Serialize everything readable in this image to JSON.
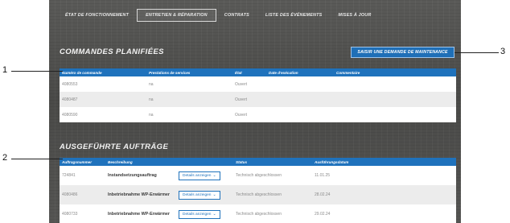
{
  "nav": {
    "tabs": [
      {
        "label": "ÉTAT DE FONCTIONNEMENT"
      },
      {
        "label": "ENTRETIEN & RÉPARATION"
      },
      {
        "label": "CONTRATS"
      },
      {
        "label": "LISTE DES ÉVÉNEMENTS"
      },
      {
        "label": "MISES À JOUR"
      }
    ],
    "active_tab": "ENTRETIEN & RÉPARATION"
  },
  "planned": {
    "title": "COMMANDES PLANIFIÉES",
    "request_button": "SAISIR UNE DEMANDE DE MAINTENANCE",
    "columns": [
      "Numéro de commande",
      "Prestations de services",
      "État",
      "Date d'exécution",
      "Commentaire"
    ],
    "rows": [
      [
        "4080553",
        "na",
        "Ouvert",
        "",
        ""
      ],
      [
        "4080487",
        "na",
        "Ouvert",
        "",
        ""
      ],
      [
        "4080590",
        "na",
        "Ouvert",
        "",
        ""
      ]
    ]
  },
  "executed": {
    "title": "AUSGEFÜHRTE AUFTRÄGE",
    "columns": [
      "Auftragsnummer",
      "Beschreibung",
      "",
      "Status",
      "Ausführungsdatum"
    ],
    "details_label": "Details anzeigen",
    "rows": [
      [
        "724841",
        "Instandsetzungsauftrag",
        "Technisch abgeschlossen",
        "11.01.25"
      ],
      [
        "4080486",
        "Inbetriebnahme WP-Erwärmer",
        "Technisch abgeschlossen",
        "28.02.24"
      ],
      [
        "4080733",
        "Inbetriebnahme WP-Erwärmer",
        "Technisch abgeschlossen",
        "29.02.24"
      ]
    ]
  },
  "callouts": [
    "1",
    "2",
    "3"
  ],
  "colors": {
    "header_blue": "#1f72bc",
    "button_blue": "#1f6fb7",
    "background": "#4f4f4d"
  }
}
